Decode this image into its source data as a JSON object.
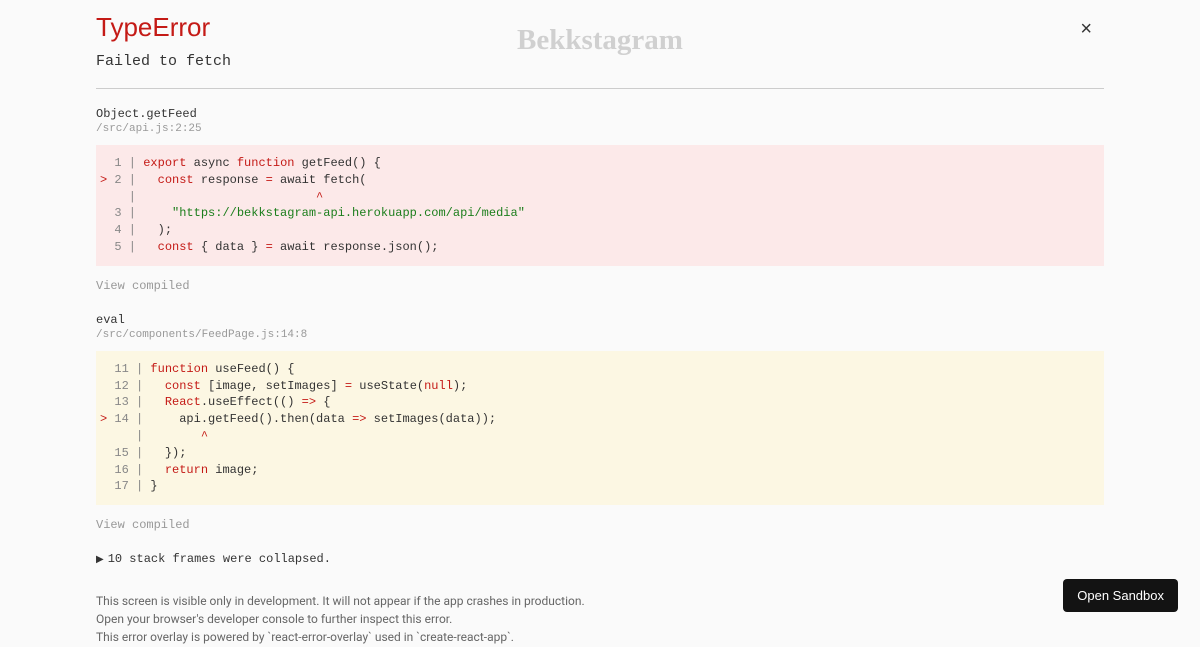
{
  "background": {
    "title": "Bekkstagram"
  },
  "error": {
    "type": "TypeError",
    "message": "Failed to fetch"
  },
  "frames": [
    {
      "method": "Object.getFeed",
      "location": "/src/api.js:2:25",
      "view_compiled_label": "View compiled",
      "code": {
        "lines": [
          {
            "gutter": "  1 | ",
            "pre": "",
            "tokens": [
              [
                "export",
                "kw-export"
              ],
              [
                " async ",
                ""
              ],
              [
                "function",
                "kw-function"
              ],
              [
                " getFeed() {",
                ""
              ]
            ]
          },
          {
            "gutter": "> 2 | ",
            "marker": true,
            "pre": "  ",
            "tokens": [
              [
                "const",
                "kw-const"
              ],
              [
                " response ",
                ""
              ],
              [
                "=",
                "op"
              ],
              [
                " await fetch(",
                ""
              ]
            ]
          },
          {
            "gutter": "    | ",
            "pre": "                        ",
            "tokens": [
              [
                "^",
                "op"
              ]
            ]
          },
          {
            "gutter": "  3 | ",
            "pre": "    ",
            "tokens": [
              [
                "\"https://bekkstagram-api.herokuapp.com/api/media\"",
                "str"
              ]
            ]
          },
          {
            "gutter": "  4 | ",
            "pre": "  ",
            "tokens": [
              [
                ");",
                ""
              ]
            ]
          },
          {
            "gutter": "  5 | ",
            "pre": "  ",
            "tokens": [
              [
                "const",
                "kw-const"
              ],
              [
                " { data } ",
                ""
              ],
              [
                "=",
                "op"
              ],
              [
                " await response.json();",
                ""
              ]
            ]
          }
        ]
      }
    },
    {
      "method": "eval",
      "location": "/src/components/FeedPage.js:14:8",
      "view_compiled_label": "View compiled",
      "code": {
        "lines": [
          {
            "gutter": "  11 | ",
            "pre": "",
            "tokens": [
              [
                "function",
                "kw-function"
              ],
              [
                " useFeed() {",
                ""
              ]
            ]
          },
          {
            "gutter": "  12 | ",
            "pre": "  ",
            "tokens": [
              [
                "const",
                "kw-const"
              ],
              [
                " [image, setImages] ",
                ""
              ],
              [
                "=",
                "op"
              ],
              [
                " useState(",
                ""
              ],
              [
                "null",
                "kw-null"
              ],
              [
                ");",
                ""
              ]
            ]
          },
          {
            "gutter": "  13 | ",
            "pre": "  ",
            "tokens": [
              [
                "React",
                "kw-react"
              ],
              [
                ".useEffect(() ",
                ""
              ],
              [
                "=>",
                "op"
              ],
              [
                " {",
                ""
              ]
            ]
          },
          {
            "gutter": "> 14 | ",
            "marker": true,
            "pre": "    ",
            "tokens": [
              [
                "api.getFeed().then(data ",
                ""
              ],
              [
                "=>",
                "op"
              ],
              [
                " setImages(data));",
                ""
              ]
            ]
          },
          {
            "gutter": "     | ",
            "pre": "       ",
            "tokens": [
              [
                "^",
                "op"
              ]
            ]
          },
          {
            "gutter": "  15 | ",
            "pre": "  ",
            "tokens": [
              [
                "});",
                ""
              ]
            ]
          },
          {
            "gutter": "  16 | ",
            "pre": "  ",
            "tokens": [
              [
                "return",
                "kw-return"
              ],
              [
                " image;",
                ""
              ]
            ]
          },
          {
            "gutter": "  17 | ",
            "pre": "",
            "tokens": [
              [
                "}",
                ""
              ]
            ]
          }
        ]
      }
    }
  ],
  "collapsed": {
    "label": "10 stack frames were collapsed."
  },
  "footer": {
    "line1": "This screen is visible only in development. It will not appear if the app crashes in production.",
    "line2": "Open your browser's developer console to further inspect this error.",
    "line3": "This error overlay is powered by `react-error-overlay` used in `create-react-app`."
  },
  "sandbox_button": "Open Sandbox"
}
